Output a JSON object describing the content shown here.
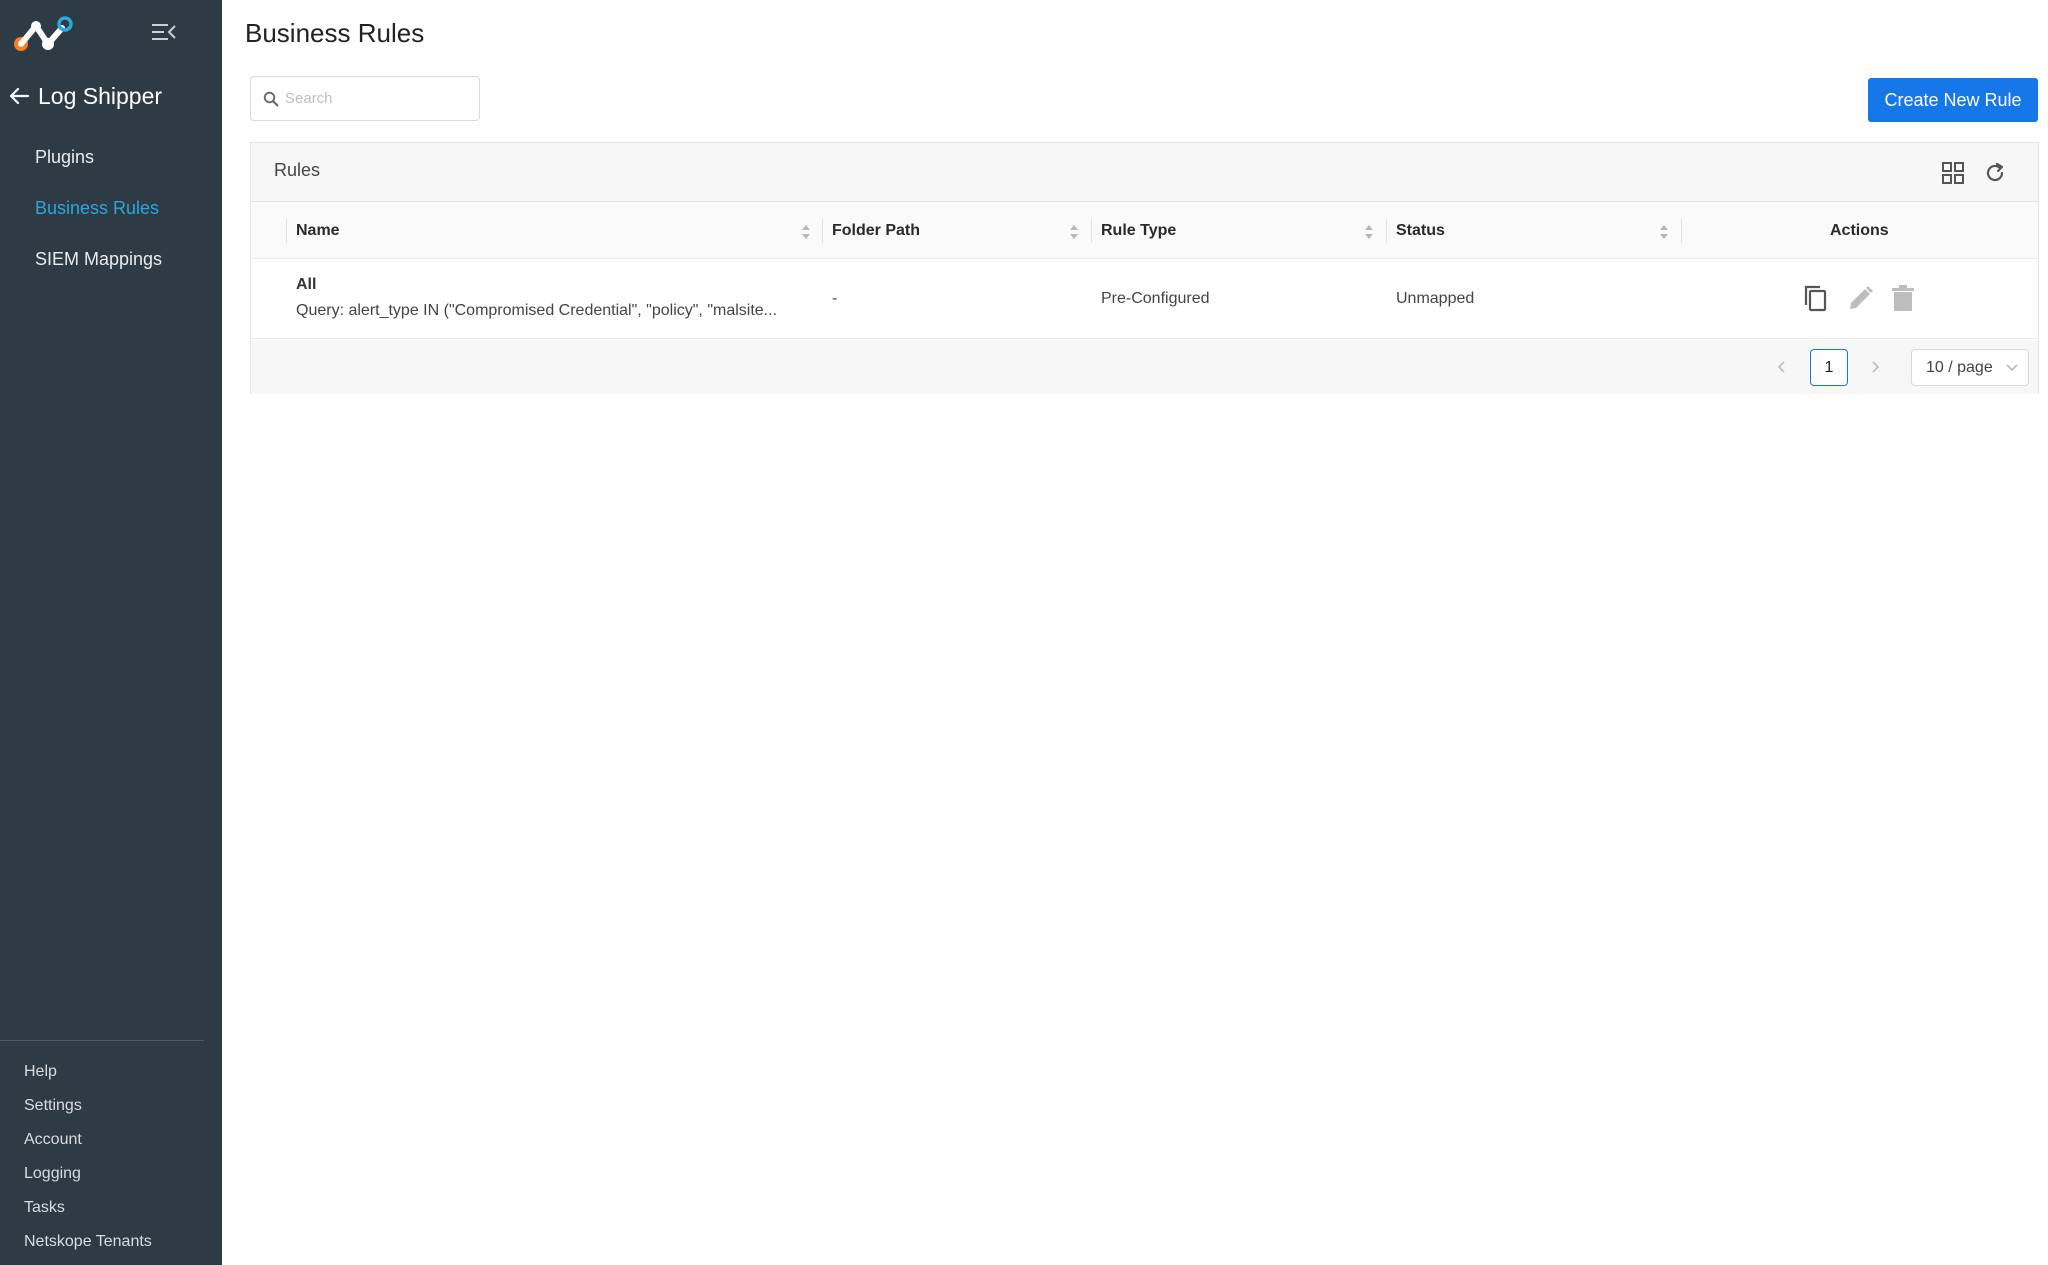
{
  "sidebar": {
    "back_label": "Log Shipper",
    "nav": [
      {
        "label": "Plugins",
        "active": false
      },
      {
        "label": "Business Rules",
        "active": true
      },
      {
        "label": "SIEM Mappings",
        "active": false
      }
    ],
    "bottom": [
      "Help",
      "Settings",
      "Account",
      "Logging",
      "Tasks",
      "Netskope Tenants"
    ]
  },
  "header": {
    "title": "Business Rules",
    "search_placeholder": "Search",
    "create_button": "Create New Rule"
  },
  "card": {
    "title": "Rules",
    "columns": [
      "Name",
      "Folder Path",
      "Rule Type",
      "Status",
      "Actions"
    ],
    "rows": [
      {
        "name": "All",
        "query": "Query: alert_type IN (\"Compromised Credential\", \"policy\", \"malsite...",
        "folder_path": "-",
        "rule_type": "Pre-Configured",
        "status": "Unmapped"
      }
    ]
  },
  "pagination": {
    "current_page": "1",
    "page_size": "10 / page"
  },
  "colors": {
    "sidebar_bg": "#2e3a44",
    "active_nav": "#29a8e0",
    "primary": "#1677e8",
    "logo_orange": "#f58220",
    "logo_blue": "#29a8e0"
  },
  "icons": {
    "collapse": "menu-fold-icon",
    "back": "arrow-left-icon",
    "search": "search-icon",
    "grid": "grid-icon",
    "refresh": "refresh-icon",
    "copy": "copy-icon",
    "edit": "edit-icon",
    "delete": "delete-icon"
  }
}
